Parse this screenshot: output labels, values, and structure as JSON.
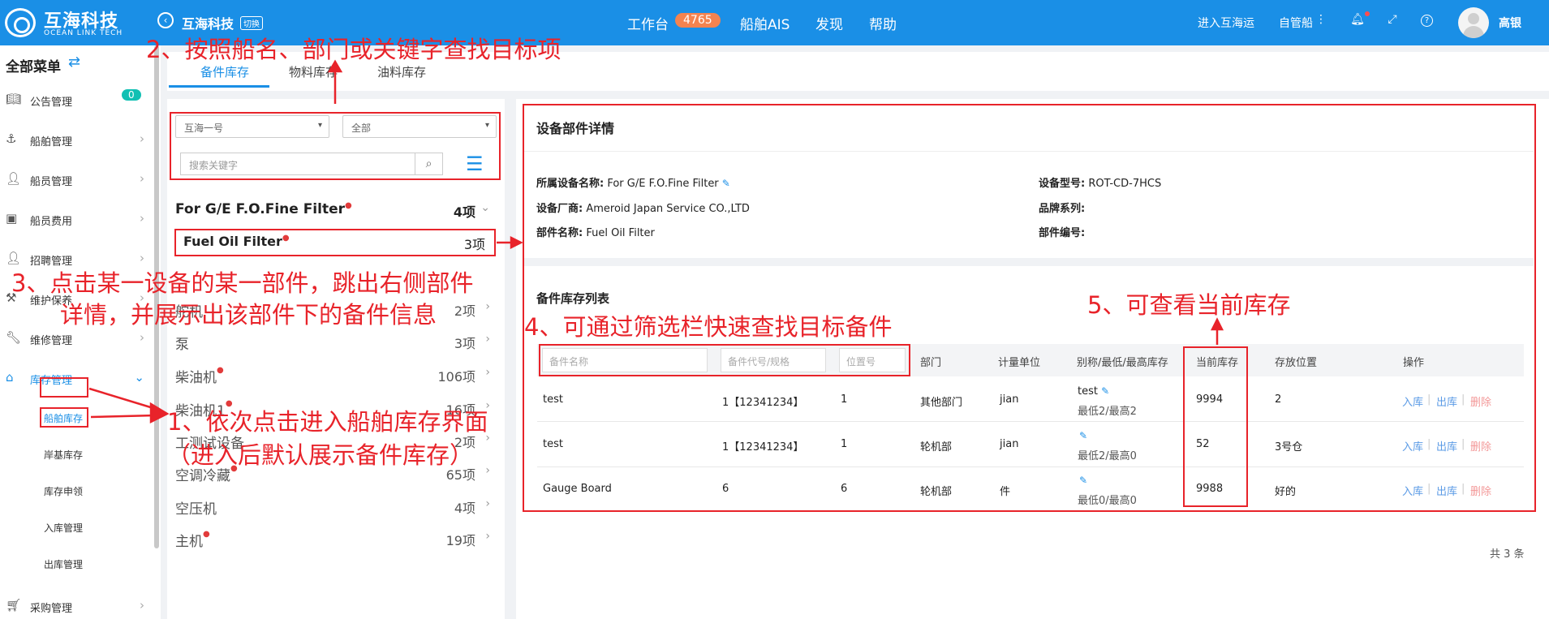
{
  "topbar": {
    "logo_cn": "互海科技",
    "logo_en": "OCEAN LINK TECH",
    "brand": "互海科技",
    "brand_badge": "切换",
    "nav": [
      "工作台",
      "船舶AIS",
      "发现",
      "帮助"
    ],
    "workbench_count": "4765",
    "enter": "进入互海运",
    "self_managed": "自管船",
    "user": "高银",
    "accent_color": "#1a8fe6"
  },
  "sidebar": {
    "title": "全部菜单",
    "items": [
      {
        "label": "公告管理",
        "icon": "book-icon",
        "badge": "0"
      },
      {
        "label": "船舶管理",
        "icon": "anchor-icon"
      },
      {
        "label": "船员管理",
        "icon": "user-icon"
      },
      {
        "label": "船员费用",
        "icon": "wallet-icon"
      },
      {
        "label": "招聘管理",
        "icon": "recruit-icon"
      },
      {
        "label": "维护保养",
        "icon": "tool-icon"
      },
      {
        "label": "维修管理",
        "icon": "wrench-icon"
      },
      {
        "label": "库存管理",
        "icon": "home-icon"
      },
      {
        "label": "采购管理",
        "icon": "cart-icon"
      }
    ],
    "sub_items": [
      "船舶库存",
      "岸基库存",
      "库存申领",
      "入库管理",
      "出库管理"
    ]
  },
  "tabs": [
    "备件库存",
    "物料库存",
    "油料库存"
  ],
  "filters": {
    "ship": "互海一号",
    "department": "全部",
    "search_placeholder": "搜索关键字"
  },
  "categories": [
    {
      "name": "For G/E F.O.Fine Filter",
      "count": "4项",
      "red_dot": true,
      "bold": true
    },
    {
      "name": "Fuel Oil Filter",
      "count": "3项",
      "red_dot": true,
      "bold": true
    },
    {
      "name": "舵机",
      "count": "2项",
      "red_dot": false
    },
    {
      "name": "泵",
      "count": "3项",
      "red_dot": false
    },
    {
      "name": "柴油机",
      "count": "106项",
      "red_dot": true
    },
    {
      "name": "柴油机1",
      "count": "16项",
      "red_dot": true
    },
    {
      "name": "工测试设备",
      "count": "2项",
      "red_dot": false
    },
    {
      "name": "空调冷藏",
      "count": "65项",
      "red_dot": true
    },
    {
      "name": "空压机",
      "count": "4项",
      "red_dot": false
    },
    {
      "name": "主机",
      "count": "19项",
      "red_dot": true
    }
  ],
  "detail": {
    "title": "设备部件详情",
    "fields": {
      "equipment_name_label": "所属设备名称:",
      "equipment_name": "For G/E F.O.Fine Filter",
      "manufacturer_label": "设备厂商:",
      "manufacturer": "Ameroid Japan Service CO.,LTD",
      "part_name_label": "部件名称:",
      "part_name": "Fuel Oil Filter",
      "model_label": "设备型号:",
      "model": "ROT-CD-7HCS",
      "brand_label": "品牌系列:",
      "brand": "",
      "part_no_label": "部件编号:",
      "part_no": ""
    }
  },
  "inventory": {
    "title": "备件库存列表",
    "filter_placeholders": [
      "备件名称",
      "备件代号/规格",
      "位置号"
    ],
    "columns": [
      "部门",
      "计量单位",
      "别称/最低/最高库存",
      "当前库存",
      "存放位置",
      "操作"
    ],
    "rows": [
      {
        "name": "test",
        "code": "1【12341234】",
        "position": "1",
        "dept": "其他部门",
        "unit": "jian",
        "alias": "test",
        "minmax": "最低2/最高2",
        "stock": "9994",
        "location": "2"
      },
      {
        "name": "test",
        "code": "1【12341234】",
        "position": "1",
        "dept": "轮机部",
        "unit": "jian",
        "alias": "",
        "minmax": "最低2/最高0",
        "stock": "52",
        "location": "3号仓"
      },
      {
        "name": "Gauge Board",
        "code": "6",
        "position": "6",
        "dept": "轮机部",
        "unit": "件",
        "alias": "",
        "minmax": "最低0/最高0",
        "stock": "9988",
        "location": "好的"
      }
    ],
    "actions": [
      "入库",
      "出库",
      "删除"
    ],
    "total": "共 3 条"
  },
  "annotations": {
    "step1_line1": "1、依次点击进入船舶库存界面",
    "step1_line2": "（进入后默认展示备件库存）",
    "step2": "2、按照船名、部门或关键字查找目标项",
    "step3_line1": "3、点击某一设备的某一部件，跳出右侧部件",
    "step3_line2": "详情，并展示出该部件下的备件信息",
    "step4": "4、可通过筛选栏快速查找目标备件",
    "step5": "5、可查看当前库存",
    "color": "#e8232a"
  }
}
